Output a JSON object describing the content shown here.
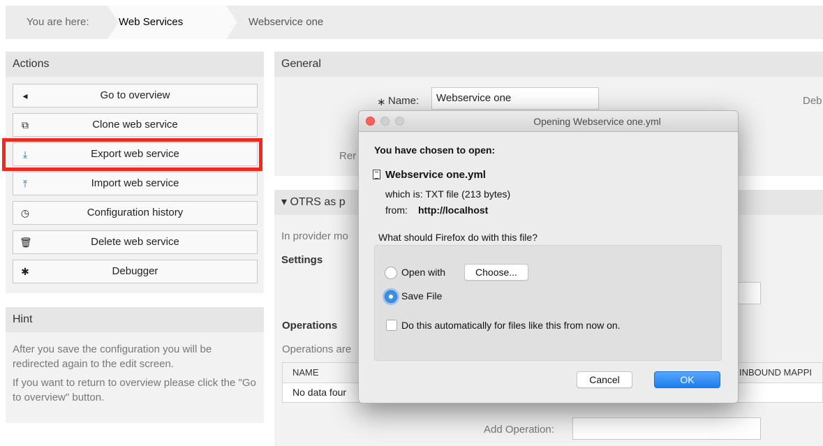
{
  "breadcrumb": {
    "you_are_here": "You are here:",
    "item1": "Web Services",
    "item2": "Webservice one"
  },
  "sidebar": {
    "actions_title": "Actions",
    "actions": [
      {
        "label": "Go to overview",
        "icon": "caret-left-icon"
      },
      {
        "label": "Clone web service",
        "icon": "clone-icon"
      },
      {
        "label": "Export web service",
        "icon": "download-icon"
      },
      {
        "label": "Import web service",
        "icon": "upload-icon"
      },
      {
        "label": "Configuration history",
        "icon": "history-icon"
      },
      {
        "label": "Delete web service",
        "icon": "trash-icon"
      },
      {
        "label": "Debugger",
        "icon": "bug-icon"
      }
    ],
    "hint_title": "Hint",
    "hint_p1": "After you save the configuration you will be redirected again to the edit screen.",
    "hint_p2": "If you want to return to overview please click the \"Go to overview\" button."
  },
  "main": {
    "general_title": "General",
    "name_required": "∗",
    "name_label": "Name:",
    "name_value": "Webservice one",
    "debug_partial": "Deb",
    "rem_partial": "Rer",
    "provider_title": "▾ OTRS as p",
    "provider_mode_partial": "In provider mo",
    "settings_label": "Settings",
    "operations_label": "Operations",
    "operations_desc_partial": "Operations are",
    "col_name": "NAME",
    "col_inbound": "INBOUND MAPPI",
    "no_data_partial": "No data four",
    "add_operation_label": "Add Operation:"
  },
  "dialog": {
    "title": "Opening Webservice one.yml",
    "chosen_to_open": "You have chosen to open:",
    "file_name": "Webservice one.yml",
    "which_is": "which is:  TXT file (213 bytes)",
    "from_label": "from:",
    "from_value": "http://localhost",
    "question": "What should Firefox do with this file?",
    "open_with_label": "Open with",
    "choose_button": "Choose...",
    "save_file_label": "Save File",
    "auto_checkbox_label": "Do this automatically for files like this from now on.",
    "cancel_button": "Cancel",
    "ok_button": "OK",
    "selected_option": "save_file"
  },
  "colors": {
    "highlight": "#f0291e",
    "accent_blue": "#1f6aa5",
    "ok_button": "#1c7df0"
  }
}
